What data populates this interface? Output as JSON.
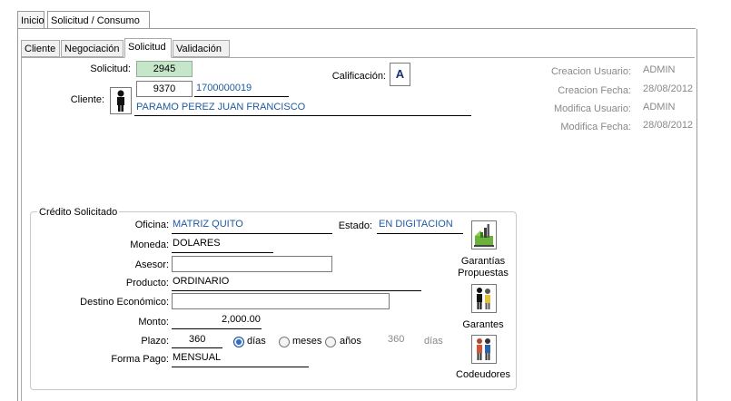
{
  "tabs": {
    "top": [
      "Inicio",
      "Solicitud / Consumo"
    ],
    "sub": [
      "Cliente",
      "Negociación",
      "Solicitud",
      "Validación"
    ]
  },
  "solicitud": {
    "label": "Solicitud:",
    "value": "2945"
  },
  "cliente": {
    "label": "Cliente:",
    "code": "9370",
    "id": "1700000019",
    "name": "PARAMO PEREZ JUAN FRANCISCO"
  },
  "calificacion": {
    "label": "Calificación:",
    "value": "A"
  },
  "audit": {
    "creacion_usuario_label": "Creacion Usuario:",
    "creacion_usuario": "ADMIN",
    "creacion_fecha_label": "Creacion Fecha:",
    "creacion_fecha": "28/08/2012",
    "modifica_usuario_label": "Modifica Usuario:",
    "modifica_usuario": "ADMIN",
    "modifica_fecha_label": "Modifica Fecha:",
    "modifica_fecha": "28/08/2012"
  },
  "credito": {
    "title": "Crédito Solicitado",
    "oficina_label": "Oficina:",
    "oficina": "MATRIZ QUITO",
    "estado_label": "Estado:",
    "estado": "EN DIGITACION",
    "moneda_label": "Moneda:",
    "moneda": "DOLARES",
    "asesor_label": "Asesor:",
    "asesor": "",
    "producto_label": "Producto:",
    "producto": "ORDINARIO",
    "destino_label": "Destino Económico:",
    "destino": "",
    "monto_label": "Monto:",
    "monto": "2,000.00",
    "plazo_label": "Plazo:",
    "plazo": "360",
    "plazo_options": [
      "días",
      "meses",
      "años"
    ],
    "plazo_selected": "días",
    "plazo_calc": "360",
    "plazo_calc_unit": "días",
    "forma_pago_label": "Forma Pago:",
    "forma_pago": "MENSUAL"
  },
  "side_buttons": {
    "garantias_line1": "Garantías",
    "garantias_line2": "Propuestas",
    "garantes": "Garantes",
    "codeudores": "Codeudores"
  },
  "icons": [
    "person-icon",
    "garantias-propuestas-icon",
    "garantes-icon",
    "codeudores-icon"
  ]
}
